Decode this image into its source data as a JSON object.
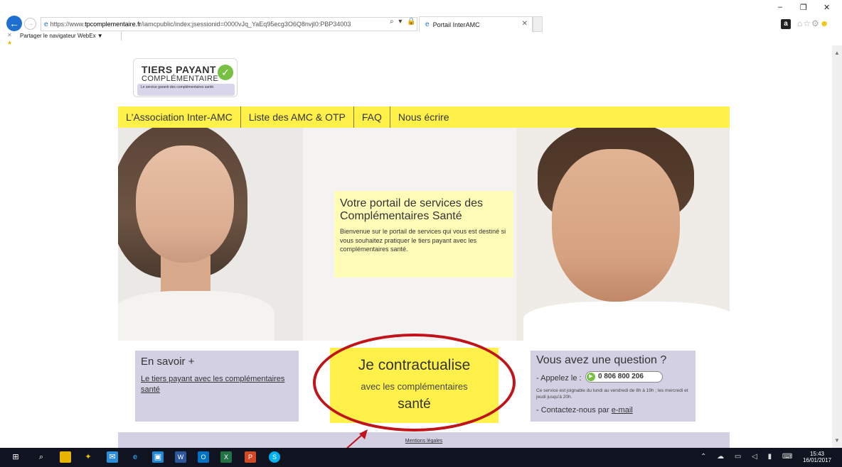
{
  "browser": {
    "url_prefix": "https://www.",
    "url_host": "tpcomplementaire.fr",
    "url_path": "/iamcpublic/index;jsessionid=0000vJq_YaEq95ecg3O6Q8nvjI0:PBP34003",
    "address_tools": "⌕ ▾ 🔒 C",
    "tab_title": "Portail InterAMC",
    "command_bar_text": "Partager le navigateur WebEx ▼",
    "amazon_icon": "a"
  },
  "logo": {
    "line1": "TIERS PAYANT",
    "line2": "COMPLÉMENTAIRE",
    "line3": "Le service garanti des complémentaires santé."
  },
  "menu": [
    {
      "label": "L'Association Inter-AMC"
    },
    {
      "label": "Liste des AMC & OTP"
    },
    {
      "label": "FAQ"
    },
    {
      "label": "Nous écrire"
    }
  ],
  "welcome": {
    "title": "Votre portail de services des Complémentaires Santé",
    "body": "Bienvenue sur le portail de services qui vous est destiné si vous souhaitez pratiquer le tiers payant avec les complémentaires santé."
  },
  "savoir": {
    "title": "En savoir +",
    "link": "Le tiers payant avec les complémentaires santé"
  },
  "contract": {
    "line1": "Je contractualise",
    "line2": "avec les complémentaires",
    "line3": "santé"
  },
  "question": {
    "title": "Vous avez une question ?",
    "call_label": "- Appelez le :",
    "phone": "0 806 800 206",
    "hours": "Ce service est joignable du lundi au vendredi de 8h à 19h ; les mercredi et jeudi jusqu'à 20h.",
    "contact_prefix": "- Contactez-nous par",
    "contact_link": "e-mail"
  },
  "footer": {
    "mentions": "Mentions légales"
  },
  "taskbar": {
    "time": "15:43",
    "date": "16/01/2017"
  },
  "colors": {
    "brand_yellow": "#fff14a",
    "lavender": "#d3d0e4",
    "annotation_red": "#c0141a"
  }
}
